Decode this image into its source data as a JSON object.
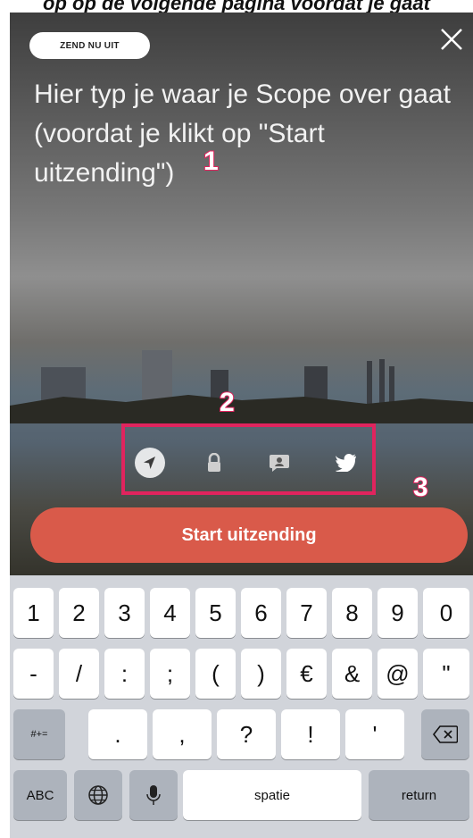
{
  "caption": "op op de volgende pagina voordat je gaat",
  "header": {
    "send_label": "ZEND NU UIT",
    "close_icon": "close-icon"
  },
  "description": {
    "text": "Hier typ je waar je Scope over gaat (voordat je klikt op \"Start uitzending\")"
  },
  "annotations": {
    "marker1": "1",
    "marker2": "2",
    "marker3": "3",
    "accent_color": "#e0245e"
  },
  "share_options": [
    {
      "icon": "location-icon"
    },
    {
      "icon": "lock-icon"
    },
    {
      "icon": "chat-icon"
    },
    {
      "icon": "twitter-icon"
    }
  ],
  "start_button": {
    "label": "Start uitzending",
    "color": "#d95a4a"
  },
  "keyboard": {
    "row1": [
      "1",
      "2",
      "3",
      "4",
      "5",
      "6",
      "7",
      "8",
      "9",
      "0"
    ],
    "row2": [
      "-",
      "/",
      ":",
      ";",
      "(",
      ")",
      "€",
      "&",
      "@",
      "\""
    ],
    "row3": [
      "#+=",
      ".",
      ",",
      "?",
      "!",
      "'"
    ],
    "row4": {
      "abc": "ABC",
      "space": "spatie",
      "return": "return"
    }
  }
}
